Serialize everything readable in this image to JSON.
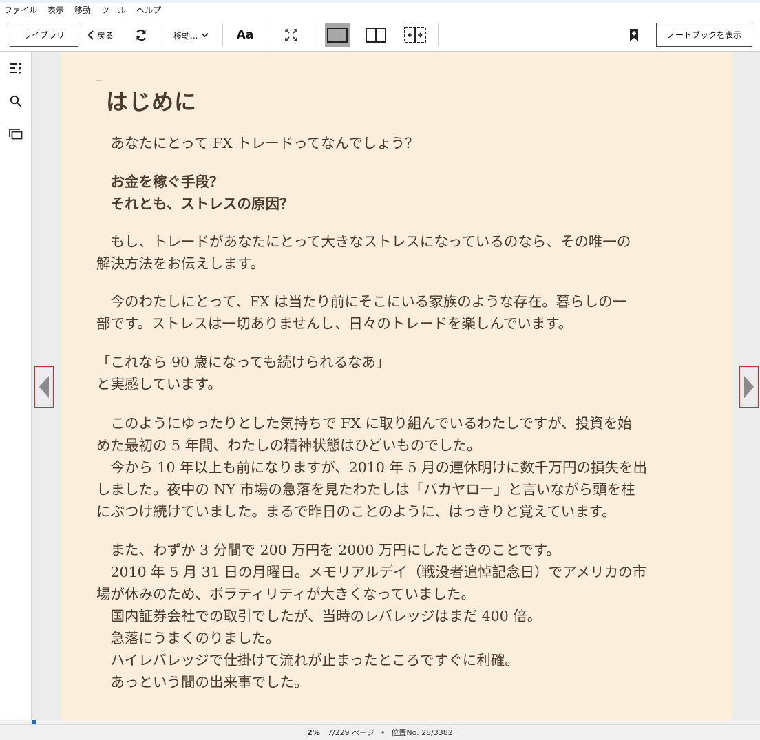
{
  "menu": [
    "ファイル",
    "表示",
    "移動",
    "ツール",
    "ヘルプ"
  ],
  "toolbar": {
    "library_label": "ライブラリ",
    "back_label": "戻る",
    "goto_label": "移動...",
    "font_label": "Aa",
    "notebook_label": "ノートブックを表示"
  },
  "book": {
    "heading": "はじめに",
    "paragraphs": [
      {
        "lines": [
          "　あなたにとって FX トレードってなんでしょう？"
        ],
        "bold": false
      },
      {
        "lines": [
          "　お金を稼ぐ手段？",
          "　それとも、ストレスの原因？"
        ],
        "bold": true
      },
      {
        "lines": [
          "　もし、トレードがあなたにとって大きなストレスになっているのなら、その唯一の",
          "解決方法をお伝えします。"
        ],
        "bold": false
      },
      {
        "lines": [
          "　今のわたしにとって、FX は当たり前にそこにいる家族のような存在。暮らしの一",
          "部です。ストレスは一切ありませんし、日々のトレードを楽しんでいます。"
        ],
        "bold": false
      },
      {
        "lines": [
          "「これなら 90 歳になっても続けられるなあ」",
          " と実感しています。"
        ],
        "bold": false
      },
      {
        "lines": [
          "　このようにゆったりとした気持ちで FX に取り組んでいるわたしですが、投資を始",
          "めた最初の 5 年間、わたしの精神状態はひどいものでした。",
          "　今から 10 年以上も前になりますが、2010 年 5 月の連休明けに数千万円の損失を出",
          "しました。夜中の NY 市場の急落を見たわたしは「バカヤロー」と言いながら頭を柱",
          "にぶつけ続けていました。まるで昨日のことのように、はっきりと覚えています。"
        ],
        "bold": false
      },
      {
        "lines": [
          "　また、わずか 3 分間で 200 万円を 2000 万円にしたときのことです。",
          "　2010 年 5 月 31 日の月曜日。メモリアルデイ（戦没者追悼記念日）でアメリカの市",
          "場が休みのため、ボラティリティが大きくなっていました。",
          "　国内証券会社での取引でしたが、当時のレバレッジはまだ 400 倍。",
          "　急落にうまくのりました。",
          "　ハイレバレッジで仕掛けて流れが止まったところですぐに利確。",
          "　あっという間の出来事でした。"
        ],
        "bold": false
      }
    ]
  },
  "status": {
    "percent": "2%",
    "page": "7/229 ページ",
    "separator": "•",
    "location": "位置No. 28/3382",
    "progress_fraction": 0.02
  },
  "colors": {
    "page_bg": "#fbeedb",
    "text": "#4a3a2e",
    "progress": "#1f6fc6",
    "nav_highlight": "#e0252b"
  },
  "icons": {
    "refresh": "refresh-icon",
    "fullscreen": "fullscreen-icon",
    "bookmark": "bookmark-add-icon",
    "toc": "table-of-contents-icon",
    "search": "search-icon",
    "flashcards": "flashcards-icon"
  }
}
